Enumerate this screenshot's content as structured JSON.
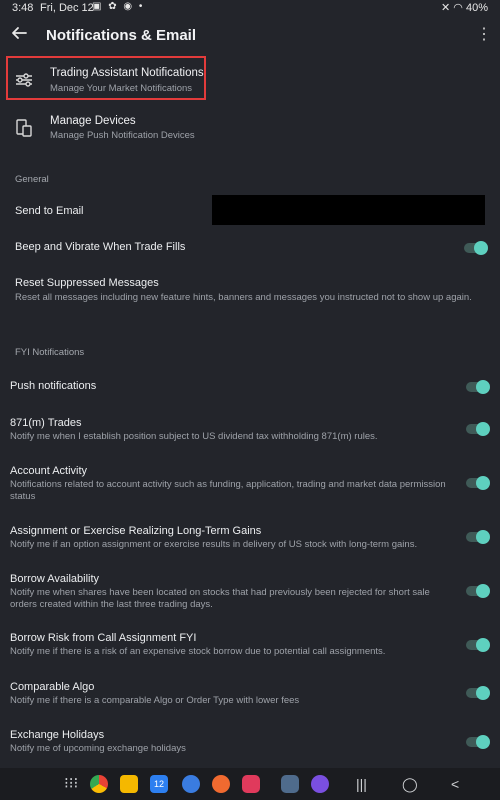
{
  "status": {
    "time": "3:48",
    "date": "Fri, Dec 12",
    "battery": "40%"
  },
  "header": {
    "title": "Notifications & Email"
  },
  "menu": [
    {
      "title": "Trading Assistant Notifications",
      "subtitle": "Manage Your Market Notifications",
      "icon": "sliders-icon"
    },
    {
      "title": "Manage Devices",
      "subtitle": "Manage Push Notification Devices",
      "icon": "devices-icon"
    }
  ],
  "general": {
    "section_label": "General",
    "send_to_email": "Send to Email",
    "beep_label": "Beep and Vibrate When Trade Fills",
    "beep_on": true,
    "reset_label": "Reset Suppressed Messages",
    "reset_desc": "Reset all messages including new feature hints, banners and messages you instructed not to show up again."
  },
  "fyi": {
    "section_label": "FYI Notifications",
    "items": [
      {
        "title": "Push notifications",
        "desc": "",
        "on": true
      },
      {
        "title": "871(m) Trades",
        "desc": "Notify me when I establish position subject to US dividend tax withholding 871(m) rules.",
        "on": true
      },
      {
        "title": "Account Activity",
        "desc": "Notifications related to account activity such as funding, application, trading and market data permission status",
        "on": true
      },
      {
        "title": "Assignment or Exercise Realizing Long-Term Gains",
        "desc": "Notify me if an option assignment or exercise results in delivery of US stock with long-term gains.",
        "on": true
      },
      {
        "title": "Borrow Availability",
        "desc": "Notify me when shares have been located on stocks that had previously been rejected for short sale orders created within the last three trading days.",
        "on": true
      },
      {
        "title": "Borrow Risk from Call Assignment FYI",
        "desc": "Notify me if there is a risk of an expensive stock borrow due to potential call assignments.",
        "on": true
      },
      {
        "title": "Comparable Algo",
        "desc": "Notify me if there is a comparable Algo or Order Type with lower fees",
        "on": true
      },
      {
        "title": "Exchange Holidays",
        "desc": "Notify me of upcoming exchange holidays",
        "on": true
      }
    ]
  },
  "colors": {
    "background": "#23252b",
    "accent": "#5ed0bf",
    "highlight_border": "#e23b3b"
  },
  "navbar": {
    "apps": [
      "apps-grid-icon",
      "chrome-icon",
      "files-icon",
      "calendar-icon",
      "messages-icon",
      "contacts-icon",
      "camera-icon",
      "settings-icon",
      "browser-icon"
    ],
    "calendar_day": "12"
  }
}
